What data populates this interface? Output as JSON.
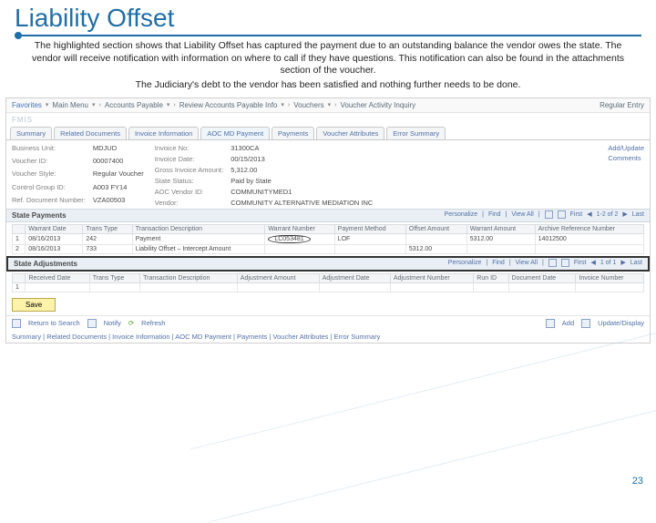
{
  "slide": {
    "title": "Liability Offset",
    "body_line1": "The highlighted section shows that Liability Offset has captured the payment due to an outstanding balance the vendor owes the state. The vendor will receive notification with information on where to call if they have questions. This notification can also be found in the attachments section of the voucher.",
    "body_line2": "The Judiciary's debt to the vendor has been satisfied and nothing further needs to be done.",
    "page_number": "23"
  },
  "breadcrumb": {
    "favorites": "Favorites",
    "main_menu": "Main Menu",
    "ap": "Accounts Payable",
    "review": "Review Accounts Payable Info",
    "vouchers": "Vouchers",
    "activity": "Voucher Activity Inquiry",
    "regular": "Regular Entry"
  },
  "app_name": "FMIS",
  "tabs": [
    "Summary",
    "Related Documents",
    "Invoice Information",
    "AOC MD Payment",
    "Payments",
    "Voucher Attributes",
    "Error Summary"
  ],
  "voucher": {
    "labels": {
      "bu": "Business Unit:",
      "vid": "Voucher ID:",
      "style": "Voucher Style:",
      "cgroup": "Control Group ID:",
      "refdoc": "Ref. Document Number:",
      "invno": "Invoice No:",
      "invdate": "Invoice Date:",
      "gross": "Gross Invoice Amount:",
      "status": "State Status:",
      "aocvendor": "AOC Vendor ID:",
      "vendor": "Vendor:"
    },
    "values": {
      "bu": "MDJUD",
      "vid": "00007400",
      "style": "Regular Voucher",
      "cgroup": "A003 FY14",
      "refdoc": "VZA00503",
      "invno": "31300CA",
      "invdate": "00/15/2013",
      "gross": "5,312.00",
      "status": "Paid by State",
      "aocvendor": "COMMUNITYMED1",
      "vendor": "COMMUNITY ALTERNATIVE MEDIATION INC"
    },
    "side": {
      "addupdate": "Add/Update",
      "comments": "Comments"
    }
  },
  "payments": {
    "title": "State Payments",
    "toolbar": {
      "personalize": "Personalize",
      "find": "Find",
      "viewall": "View All",
      "pager": "1-2 of 2",
      "first": "First",
      "last": "Last"
    },
    "headers": [
      "",
      "Warrant Date",
      "Trans Type",
      "Transaction Description",
      "Warrant Number",
      "Payment Method",
      "Offset Amount",
      "Warrant Amount",
      "Archive Reference Number"
    ],
    "rows": [
      {
        "idx": "1",
        "date": "08/16/2013",
        "type": "242",
        "desc": "Payment",
        "warrant": "LC053481",
        "method": "LOF",
        "offset": "",
        "amount": "5312.00",
        "arn": "14012500"
      },
      {
        "idx": "2",
        "date": "08/16/2013",
        "type": "733",
        "desc": "Liability Offset – Intercept Amount",
        "warrant": "",
        "method": "",
        "offset": "5312.00",
        "amount": "",
        "arn": ""
      }
    ]
  },
  "adjustments": {
    "title": "State Adjustments",
    "toolbar": {
      "personalize": "Personalize",
      "find": "Find",
      "viewall": "View All",
      "pager": "1 of 1",
      "first": "First",
      "last": "Last"
    },
    "headers": [
      "",
      "Received Date",
      "Trans Type",
      "Transaction Description",
      "Adjustment Amount",
      "Adjustment Date",
      "Adjustment Number",
      "Run ID",
      "Document Date",
      "Invoice Number"
    ],
    "row": {
      "idx": "1"
    }
  },
  "buttons": {
    "save": "Save"
  },
  "bottom": {
    "return": "Return to Search",
    "notify": "Notify",
    "refresh": "Refresh",
    "add": "Add",
    "update": "Update/Display"
  },
  "tabs_text": "Summary | Related Documents | Invoice Information | AOC MD Payment | Payments | Voucher Attributes | Error Summary"
}
